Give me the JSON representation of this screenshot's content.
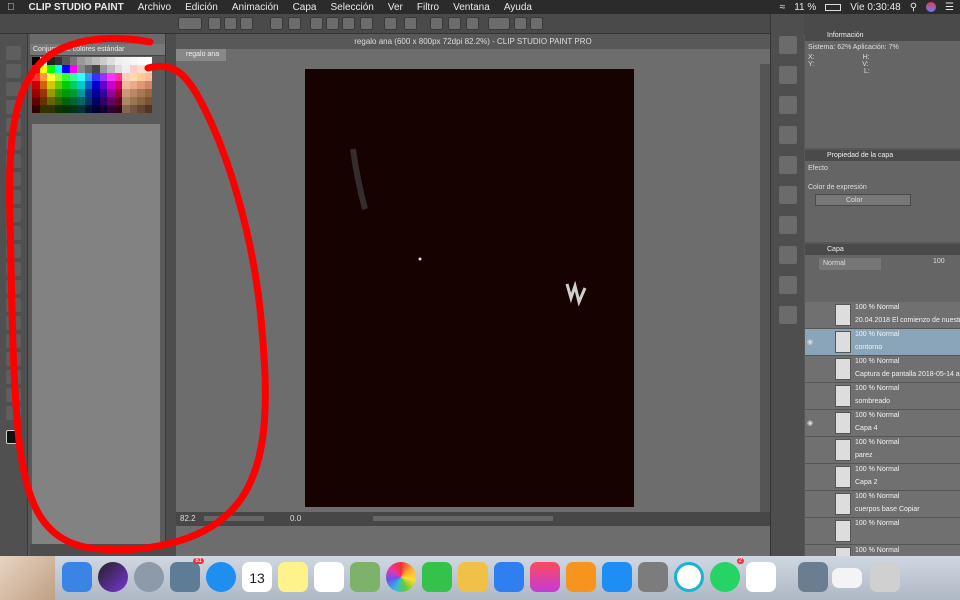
{
  "menubar": {
    "app_name": "CLIP STUDIO PAINT",
    "items": [
      "Archivo",
      "Edición",
      "Animación",
      "Capa",
      "Selección",
      "Ver",
      "Filtro",
      "Ventana",
      "Ayuda"
    ],
    "battery": "11 %",
    "clock": "Vie 0:30:48"
  },
  "color_panel": {
    "title": "Conjunto de colores estándar"
  },
  "document": {
    "tab": "regalo ana",
    "title": "regalo ana (600 x 800px 72dpi 82.2%)  - CLIP STUDIO PAINT PRO",
    "zoom": "82.2",
    "rotation": "0.0",
    "canvas_color": "#170202"
  },
  "info_panel": {
    "title": "Información",
    "system_label": "Sistema:",
    "system_value": "62%",
    "app_label": "Aplicación:",
    "app_value": "7%",
    "x": "X:",
    "y": "Y:",
    "h": "H:",
    "v": "V:",
    "l": "L:"
  },
  "property_panel": {
    "title": "Propiedad de la capa",
    "effect_label": "Efecto",
    "expression_label": "Color de expresión",
    "expression_value": "Color"
  },
  "layer_panel": {
    "title": "Capa",
    "blend_mode": "Normal",
    "opacity": "100",
    "layers": [
      {
        "l1": "100 % Normal",
        "l2": "20.04.2018 El comienzo de nuestr",
        "visible": false,
        "selected": false
      },
      {
        "l1": "100 % Normal",
        "l2": "contorno",
        "visible": true,
        "selected": true
      },
      {
        "l1": "100 % Normal",
        "l2": "Captura de pantalla 2018-05-14 a",
        "visible": false,
        "selected": false
      },
      {
        "l1": "100 % Normal",
        "l2": "sombreado",
        "visible": false,
        "selected": false
      },
      {
        "l1": "100 % Normal",
        "l2": "Capa 4",
        "visible": true,
        "selected": false
      },
      {
        "l1": "100 % Normal",
        "l2": "parez",
        "visible": false,
        "selected": false
      },
      {
        "l1": "100 % Normal",
        "l2": "Capa 2",
        "visible": false,
        "selected": false
      },
      {
        "l1": "100 % Normal",
        "l2": "cuerpos base Copiar",
        "visible": false,
        "selected": false
      },
      {
        "l1": "100 % Normal",
        "l2": "",
        "visible": false,
        "selected": false
      },
      {
        "l1": "100 % Normal",
        "l2": "",
        "visible": false,
        "selected": false
      }
    ]
  },
  "dock": {
    "calendar_day": "13",
    "badge_photos": "81",
    "badge_whatsapp": "2"
  },
  "colors": {
    "annotation_red": "#ff0000",
    "selected_layer": "#8aa5b8"
  }
}
